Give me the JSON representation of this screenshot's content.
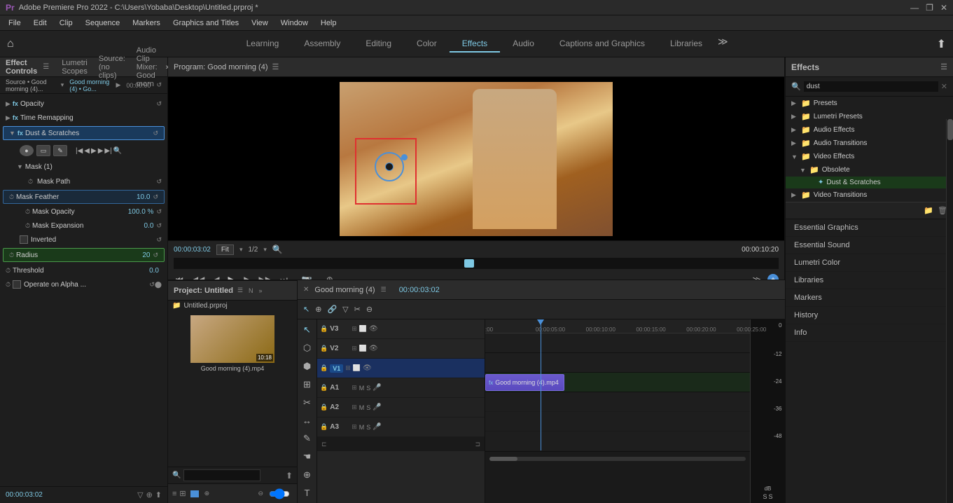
{
  "titlebar": {
    "title": "Adobe Premiere Pro 2022 - C:\\Users\\Yobaba\\Desktop\\Untitled.prproj *",
    "controls": [
      "—",
      "❐",
      "✕"
    ]
  },
  "menubar": {
    "items": [
      "File",
      "Edit",
      "Clip",
      "Sequence",
      "Markers",
      "Graphics and Titles",
      "View",
      "Window",
      "Help"
    ]
  },
  "workspaceTabs": {
    "items": [
      "Learning",
      "Assembly",
      "Editing",
      "Color",
      "Effects",
      "Audio",
      "Captions and Graphics",
      "Libraries"
    ],
    "active": "Effects",
    "moreIcon": "≫"
  },
  "effectControls": {
    "title": "Effect Controls",
    "panelHeader": "Effect Controls",
    "sourceLabel": "Source • Good morning (4)...",
    "sourceName": "Good morning (4) • Go...",
    "effects": {
      "opacity": "Opacity",
      "timeRemapping": "Time Remapping",
      "dustScratches": "Dust & Scratches",
      "mask": "Mask (1)",
      "maskPath": "Mask Path",
      "maskFeather": "Mask Feather",
      "maskFeatherValue": "10.0",
      "maskOpacity": "Mask Opacity",
      "maskOpacityValue": "100.0 %",
      "maskExpansion": "Mask Expansion",
      "maskExpansionValue": "0.0",
      "inverted": "Inverted",
      "radius": "Radius",
      "radiusValue": "20",
      "threshold": "Threshold",
      "thresholdValue": "0.0",
      "operateOnAlpha": "Operate on Alpha ..."
    },
    "timeDisplay": "00:00:03:02"
  },
  "programMonitor": {
    "title": "Program: Good morning (4)",
    "currentTime": "00:00:03:02",
    "fit": "Fit",
    "ratio": "1/2",
    "duration": "00:00:10:20",
    "controls": [
      "⏮",
      "◀◀",
      "◀",
      "▶",
      "▶▶",
      "⏭"
    ],
    "playBtn": "▶"
  },
  "timeline": {
    "title": "Good morning (4)",
    "currentTime": "00:00:03:02",
    "tracks": {
      "video": [
        "V3",
        "V2",
        "V1"
      ],
      "audio": [
        "A1",
        "A2",
        "A3"
      ]
    },
    "timeMarkers": [
      ":00",
      "00:00:05:00",
      "00:00:10:00",
      "00:00:15:00",
      "00:00:20:00",
      "00:00:25:00"
    ],
    "clips": [
      {
        "label": "Good morning (4).mp4",
        "track": "V1",
        "startPercent": 0,
        "widthPercent": 28
      }
    ]
  },
  "effects": {
    "title": "Effects",
    "searchPlaceholder": "dust",
    "tree": {
      "presets": "Presets",
      "lumetriPresets": "Lumetri Presets",
      "audioEffects": "Audio Effects",
      "audioTransitions": "Audio Transitions",
      "videoEffects": "Video Effects",
      "obsolete": "Obsolete",
      "dustScratches": "Dust & Scratches",
      "videoTransitions": "Video Transitions"
    }
  },
  "panelsList": {
    "items": [
      "Essential Graphics",
      "Essential Sound",
      "Lumetri Color",
      "Libraries",
      "Markers",
      "History",
      "Info"
    ]
  },
  "project": {
    "title": "Project: Untitled",
    "filename": "Untitled.prproj",
    "clip": {
      "name": "Good morning (4).mp4",
      "duration": "10:18"
    }
  },
  "vuMeter": {
    "marks": [
      "0",
      "-12",
      "-24",
      "-36",
      "-48"
    ],
    "dbLabel": "dB",
    "sBtn": "S",
    "sBtn2": "S"
  }
}
